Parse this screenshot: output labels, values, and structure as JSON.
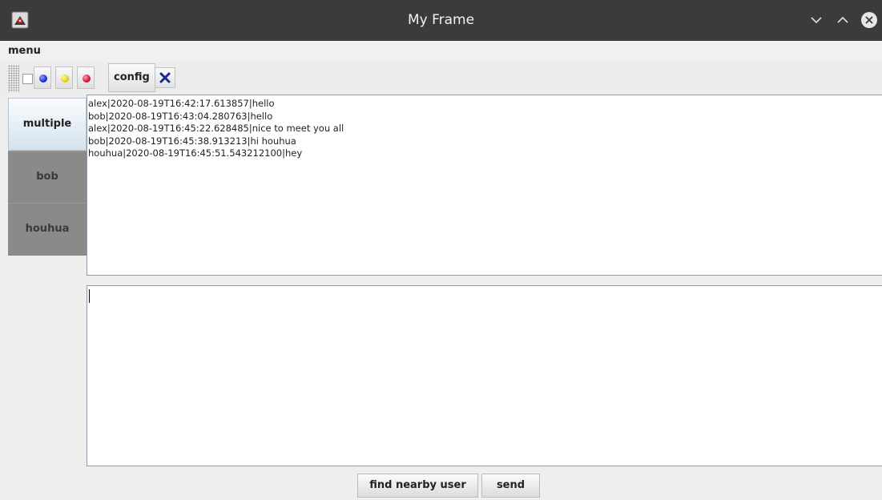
{
  "window": {
    "title": "My Frame",
    "icons": {
      "app": "java-duke-icon",
      "minimize": "chevron-down-icon",
      "maximize": "chevron-up-icon",
      "close": "close-circle-icon"
    }
  },
  "menubar": {
    "items": [
      "menu"
    ]
  },
  "toolbar": {
    "checkbox_checked": false,
    "ball_buttons": [
      {
        "icon": "blue-ball-icon",
        "color": "#1a2fd6"
      },
      {
        "icon": "yellow-ball-icon",
        "color": "#e4d21a"
      },
      {
        "icon": "red-ball-icon",
        "color": "#d4143c"
      }
    ],
    "config_label": "config",
    "close_icon": "x-icon"
  },
  "side_tabs": [
    {
      "label": "multiple",
      "selected": true
    },
    {
      "label": "bob",
      "selected": false
    },
    {
      "label": "houhua",
      "selected": false
    }
  ],
  "messages": [
    "alex|2020-08-19T16:42:17.613857|hello",
    "bob|2020-08-19T16:43:04.280763|hello",
    "alex|2020-08-19T16:45:22.628485|nice to meet you all",
    "bob|2020-08-19T16:45:38.913213|hi houhua",
    "houhua|2020-08-19T16:45:51.543212100|hey"
  ],
  "input": {
    "value": ""
  },
  "buttons": {
    "find_nearby": "find nearby user",
    "send": "send"
  },
  "colors": {
    "titlebar": "#3b3b3b",
    "selected_tab": "#d4e2ee",
    "unselected_tab": "#8a8a8a"
  }
}
